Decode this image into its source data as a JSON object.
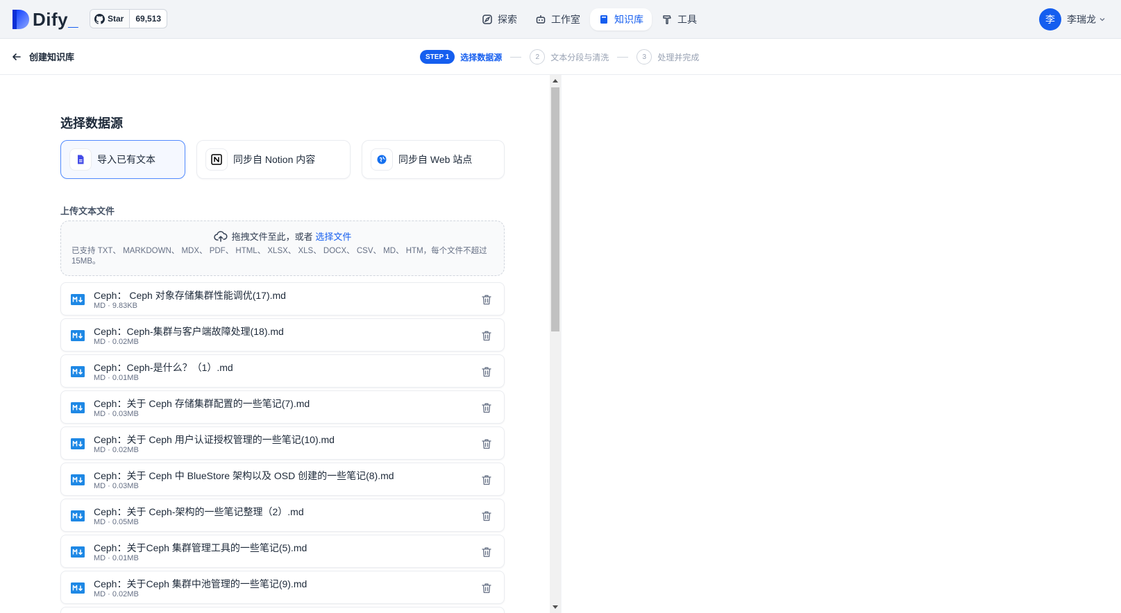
{
  "header": {
    "brand": "Dify",
    "brand_suffix": "_",
    "github": {
      "star_label": "Star",
      "star_count": "69,513"
    },
    "nav": [
      {
        "label": "探索",
        "icon": "compass-icon",
        "active": false
      },
      {
        "label": "工作室",
        "icon": "robot-icon",
        "active": false
      },
      {
        "label": "知识库",
        "icon": "book-icon",
        "active": true
      },
      {
        "label": "工具",
        "icon": "hammer-icon",
        "active": false
      }
    ],
    "user": {
      "avatar_text": "李",
      "name": "李瑞龙"
    }
  },
  "subheader": {
    "title": "创建知识库",
    "steps": [
      {
        "badge": "STEP 1",
        "label": "选择数据源",
        "active": true
      },
      {
        "num": "2",
        "label": "文本分段与清洗",
        "active": false
      },
      {
        "num": "3",
        "label": "处理并完成",
        "active": false
      }
    ]
  },
  "main": {
    "section_title": "选择数据源",
    "sources": [
      {
        "label": "导入已有文本",
        "icon": "file-text-icon",
        "active": true
      },
      {
        "label": "同步自 Notion 内容",
        "icon": "notion-icon",
        "active": false
      },
      {
        "label": "同步自 Web 站点",
        "icon": "globe-icon",
        "active": false
      }
    ],
    "upload_label": "上传文本文件",
    "dropzone": {
      "text": "拖拽文件至此，或者",
      "link": "选择文件",
      "tip": "已支持 TXT、 MARKDOWN、 MDX、 PDF、 HTML、 XLSX、 XLS、 DOCX、 CSV、 MD、 HTM，每个文件不超过 15MB。"
    },
    "files": [
      {
        "name": "Ceph： Ceph 对象存储集群性能调优(17).md",
        "meta": "MD · 9.83KB"
      },
      {
        "name": "Ceph：Ceph-集群与客户端故障处理(18).md",
        "meta": "MD · 0.02MB"
      },
      {
        "name": "Ceph：Ceph-是什么？（1）.md",
        "meta": "MD · 0.01MB"
      },
      {
        "name": "Ceph：关于 Ceph 存储集群配置的一些笔记(7).md",
        "meta": "MD · 0.03MB"
      },
      {
        "name": "Ceph：关于 Ceph 用户认证授权管理的一些笔记(10).md",
        "meta": "MD · 0.02MB"
      },
      {
        "name": "Ceph：关于 Ceph 中 BlueStore 架构以及 OSD 创建的一些笔记(8).md",
        "meta": "MD · 0.03MB"
      },
      {
        "name": "Ceph：关于 Ceph-架构的一些笔记整理（2）.md",
        "meta": "MD · 0.05MB"
      },
      {
        "name": "Ceph：关于Ceph 集群管理工具的一些笔记(5).md",
        "meta": "MD · 0.01MB"
      },
      {
        "name": "Ceph：关于Ceph 集群中池管理的一些笔记(9).md",
        "meta": "MD · 0.02MB"
      },
      {
        "name": "",
        "meta": ""
      }
    ]
  },
  "colors": {
    "accent": "#155eef",
    "markdown_icon": "#1e88e5"
  }
}
